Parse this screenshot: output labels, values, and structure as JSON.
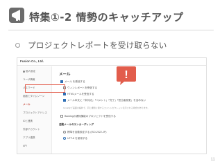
{
  "slide": {
    "title": "特集①-2 情勢のキャッチアップ",
    "bullet": "プロジェクトレポートを受け取らない",
    "page_number": "11",
    "icon": "megaphone-icon",
    "accent_color": "#e25d4c"
  },
  "screenshot": {
    "company": "Fusion Co., Ltd.",
    "sidebar": {
      "items": [
        {
          "label": "個人設定",
          "active": false,
          "dot": true
        },
        {
          "label": "ユーザ情報",
          "active": false,
          "dot": false
        },
        {
          "label": "パスワード",
          "active": false,
          "dot": false
        },
        {
          "label": "画面とタイムゾーン",
          "active": false,
          "dot": false
        },
        {
          "label": "メール",
          "active": true,
          "dot": false
        },
        {
          "label": "プロジェクトアドレス",
          "active": false,
          "dot": false
        },
        {
          "label": "IDと連携",
          "active": false,
          "dot": false
        },
        {
          "label": "外部アカウント",
          "active": false,
          "dot": false
        },
        {
          "label": "アプリ連携",
          "active": false,
          "dot": false
        },
        {
          "label": "API",
          "active": false,
          "dot": false
        }
      ]
    },
    "main": {
      "title": "メール",
      "options": [
        {
          "label": "メール を受信する",
          "type": "checkbox",
          "checked": true
        },
        {
          "label": "ウィンレポートを受信する",
          "type": "checkbox",
          "checked": false
        },
        {
          "label": "HTMLメールを受信する",
          "type": "checkbox",
          "checked": true
        },
        {
          "label": "メール本文に「未対応」「コメント」「完了」「担当者変更」を含めない",
          "type": "checkbox",
          "checked": true
        }
      ],
      "help_text": "Gmailなど画面の縮約で、同じ課題に関するコメントがスレッド表示される場合があります。",
      "option_backlog": "Backlogの通知機能のプロジェクトを受信する",
      "section2_title": "活動メールのエンカーディング",
      "radios": [
        {
          "label": "標準を自動設定する (ISO-2022-JP)",
          "checked": false
        },
        {
          "label": "UTF-8 を使用する",
          "checked": true
        }
      ]
    },
    "alert_mark": "!"
  }
}
